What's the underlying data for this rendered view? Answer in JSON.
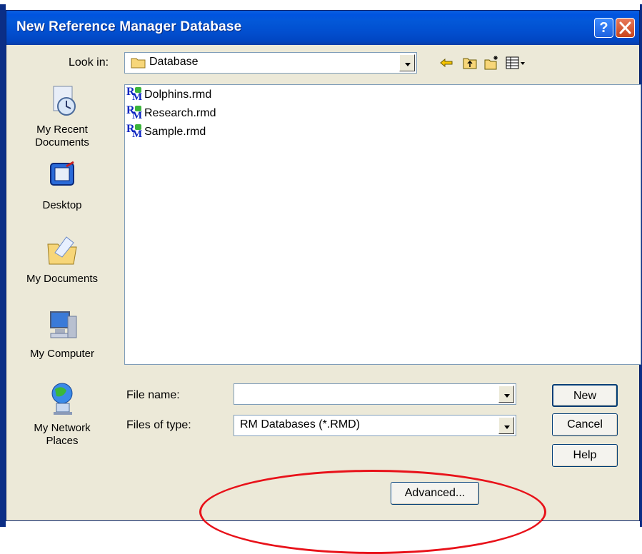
{
  "window": {
    "title": "New Reference Manager Database"
  },
  "look_in": {
    "label": "Look in:",
    "value": "Database"
  },
  "toolbar": {
    "icons": [
      "back-arrow-icon",
      "up-folder-icon",
      "new-folder-icon",
      "view-menu-icon"
    ]
  },
  "places": [
    {
      "label_lines": [
        "My Recent",
        "Documents"
      ],
      "icon": "recent-documents-icon"
    },
    {
      "label_lines": [
        "Desktop"
      ],
      "icon": "desktop-icon"
    },
    {
      "label_lines": [
        "My Documents"
      ],
      "icon": "my-documents-icon"
    },
    {
      "label_lines": [
        "My Computer"
      ],
      "icon": "my-computer-icon"
    },
    {
      "label_lines": [
        "My Network",
        "Places"
      ],
      "icon": "network-places-icon"
    }
  ],
  "files": [
    {
      "name": "Dolphins.rmd"
    },
    {
      "name": "Research.rmd"
    },
    {
      "name": "Sample.rmd"
    }
  ],
  "file_name": {
    "label": "File name:",
    "value": ""
  },
  "file_type": {
    "label": "Files of type:",
    "value": "RM Databases (*.RMD)"
  },
  "buttons": {
    "new": "New",
    "cancel": "Cancel",
    "help": "Help",
    "advanced": "Advanced..."
  },
  "colors": {
    "titlebar": "#0053e0",
    "dialog_bg": "#ece9d8",
    "annotation": "#e8121a"
  }
}
